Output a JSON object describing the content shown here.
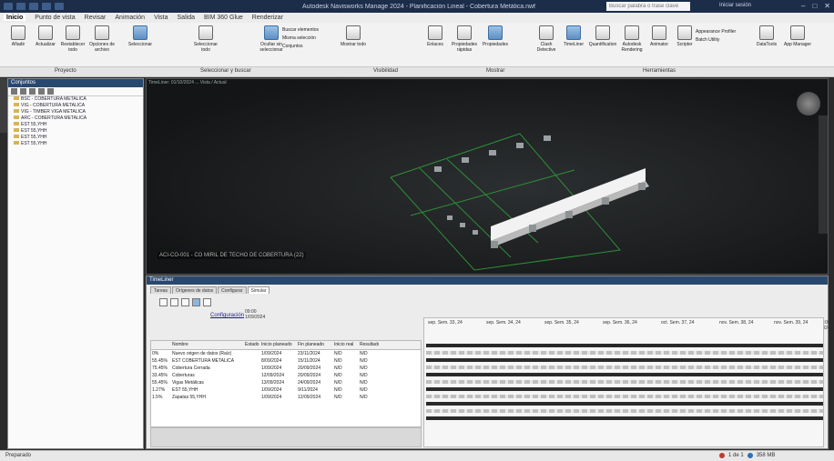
{
  "window": {
    "title": "Autodesk Navisworks Manage 2024 - Planificación Lineal - Cobertura Metálica.nwf",
    "search_placeholder": "Buscar palabra o frase clave",
    "user": "Iniciar sesión"
  },
  "tabs": [
    "Inicio",
    "Punto de vista",
    "Revisar",
    "Animación",
    "Vista",
    "Salida",
    "BIM 360 Glue",
    "Renderizar"
  ],
  "ribbon": {
    "buttons": [
      {
        "label": "Añadir"
      },
      {
        "label": "Actualizar"
      },
      {
        "label": "Restablecer todo"
      },
      {
        "label": "Opciones de archivo"
      },
      {
        "label": "Seleccionar"
      },
      {
        "label": "Seleccionar todo"
      },
      {
        "label": "Ocultar sin seleccionar"
      },
      {
        "label": "Mostrar todo"
      },
      {
        "label": "Enlaces"
      },
      {
        "label": "Propiedades rápidas"
      },
      {
        "label": "Propiedades"
      },
      {
        "label": "Clash Detective"
      },
      {
        "label": "TimeLiner"
      },
      {
        "label": "Quantification"
      },
      {
        "label": "Autodesk Rendering"
      },
      {
        "label": "Animator"
      },
      {
        "label": "Scripter"
      },
      {
        "label": "DataTools"
      },
      {
        "label": "App Manager"
      }
    ],
    "small": {
      "find": "Buscar elementos",
      "same": "Misma selección",
      "sets": "Conjuntos",
      "appearance": "Appearance Profiler",
      "batch": "Batch Utility"
    },
    "groups": [
      "Proyecto",
      "Seleccionar y buscar",
      "Visibilidad",
      "Mostrar",
      "Herramientas"
    ]
  },
  "left_panel": {
    "title": "Conjuntos",
    "items": [
      "BSC - COBERTURA METALICA",
      "VIG - COBERTURA METALICA",
      "VIG - TIMBER VIGA METALICA",
      "ARC - COBERTURA METALICA",
      "EST 55,YHH",
      "EST 55,YHH",
      "EST 55,YHH",
      "EST 55,YHH"
    ]
  },
  "viewport": {
    "caption": "TimeLiner: 01/10/2024 ... Vista / Actual",
    "selected_label": "ACI-CO-001 - CO MIRIL DE TECHO DE COBERTURA (22)"
  },
  "timeliner": {
    "title": "TimeLiner",
    "tabs": [
      "Tareas",
      "Orígenes de datos",
      "Configurar",
      "Simular"
    ],
    "config_label": "Configuración",
    "date_top": "09:00",
    "date_bottom": "1/09/2024",
    "date_right_top": "10:00",
    "date_right_bottom": "23/11/2024",
    "columns": [
      "",
      "Nombre",
      "Estado",
      "Inicio planeado",
      "Fin planeado",
      "Inicio real",
      "Resultado"
    ],
    "rows": [
      {
        "pct": "0%",
        "name": "Nuevo origen de datos (Raíz)",
        "state": "",
        "start": "1/09/2024",
        "end": "23/11/2024",
        "real": "N/D",
        "result": "N/D"
      },
      {
        "pct": "55.45%",
        "name": "EST COBERTURA METALICA",
        "state": "",
        "start": "8/09/2024",
        "end": "15/11/2024",
        "real": "N/D",
        "result": "N/D"
      },
      {
        "pct": "75.45%",
        "name": "Cobertura Cerrada",
        "state": "",
        "start": "1/09/2024",
        "end": "20/09/2024",
        "real": "N/D",
        "result": "N/D"
      },
      {
        "pct": "33.45%",
        "name": "Coberturas",
        "state": "",
        "start": "12/09/2024",
        "end": "20/09/2024",
        "real": "N/D",
        "result": "N/D"
      },
      {
        "pct": "55.45%",
        "name": "Vigas Metálicas",
        "state": "",
        "start": "13/09/2024",
        "end": "24/09/2024",
        "real": "N/D",
        "result": "N/D"
      },
      {
        "pct": "1.27%",
        "name": "EST 55,YHH",
        "state": "",
        "start": "1/09/2024",
        "end": "9/11/2024",
        "real": "N/D",
        "result": "N/D"
      },
      {
        "pct": "1.5%",
        "name": "Zapatas 55,YHH",
        "state": "",
        "start": "1/09/2024",
        "end": "12/09/2024",
        "real": "N/D",
        "result": "N/D"
      }
    ],
    "gantt_headers": [
      "sep. Sem. 33, 24",
      "sep. Sem. 34, 24",
      "sep. Sem. 35, 24",
      "sep. Sem. 36, 24",
      "oct. Sem. 37, 24",
      "nov. Sem. 38, 24",
      "nov. Sem. 39, 24"
    ]
  },
  "status": {
    "left": "Preparado",
    "count": "1 de 1",
    "memory": "358 MB"
  }
}
